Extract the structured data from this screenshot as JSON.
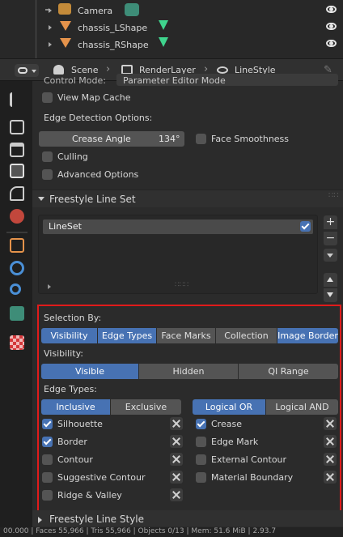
{
  "outliner": {
    "items": [
      {
        "label": "Camera"
      },
      {
        "label": "chassis_LShape"
      },
      {
        "label": "chassis_RShape"
      }
    ]
  },
  "header": {
    "scene_label": "Scene",
    "renderlayer_label": "RenderLayer",
    "linestyle_label": "LineStyle"
  },
  "top_panel": {
    "control_mode_label": "Control Mode:",
    "control_mode_value": "Parameter Editor Mode",
    "view_map_cache": "View Map Cache",
    "edge_detection_label": "Edge Detection Options:",
    "crease_angle_label": "Crease Angle",
    "crease_angle_value": "134°",
    "face_smoothness": "Face Smoothness",
    "culling": "Culling",
    "advanced_options": "Advanced Options"
  },
  "lineset_panel": {
    "title": "Freestyle Line Set",
    "item_name": "LineSet"
  },
  "selection": {
    "selection_by_label": "Selection By:",
    "selection_buttons": [
      "Visibility",
      "Edge Types",
      "Face Marks",
      "Collection",
      "Image Border"
    ],
    "visibility_label": "Visibility:",
    "visibility_buttons": [
      "Visible",
      "Hidden",
      "QI Range"
    ],
    "edge_types_label": "Edge Types:",
    "mode_buttons": [
      "Inclusive",
      "Exclusive"
    ],
    "logic_buttons": [
      "Logical OR",
      "Logical AND"
    ],
    "left_edges": [
      "Silhouette",
      "Border",
      "Contour",
      "Suggestive Contour",
      "Ridge & Valley"
    ],
    "right_edges": [
      "Crease",
      "Edge Mark",
      "External Contour",
      "Material Boundary"
    ]
  },
  "linestyle_panel": {
    "title": "Freestyle Line Style"
  },
  "status_bar": {
    "text": "00.000 | Faces 55,966 | Tris 55,966 | Objects 0/13 | Mem: 51.6 MiB | 2.93.7"
  },
  "colors": {
    "accent": "#4772b3",
    "highlight_border": "#e01b1b",
    "panel_bg": "#2b2b2b",
    "button_bg": "#545454"
  }
}
